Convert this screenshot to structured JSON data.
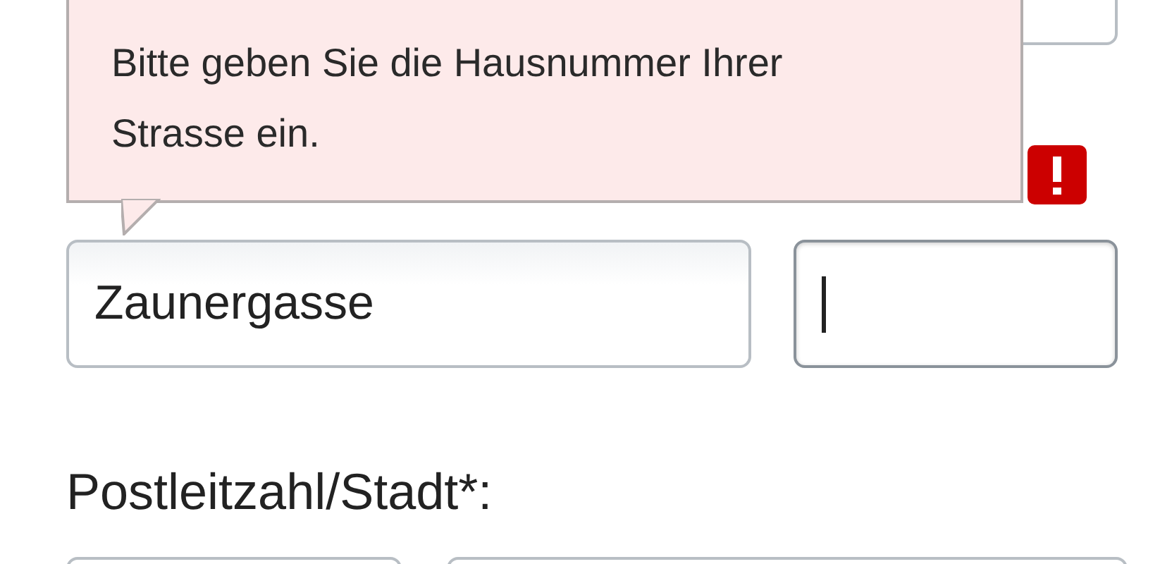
{
  "tooltip": {
    "text": "Bitte geben Sie die Hausnummer Ihrer Strasse ein."
  },
  "address_row": [
    {
      "value": "Zaunergasse",
      "focused": false,
      "error": false
    },
    {
      "focused": true,
      "error": true
    }
  ],
  "postal_label": "Postleitzahl/Stadt*:"
}
